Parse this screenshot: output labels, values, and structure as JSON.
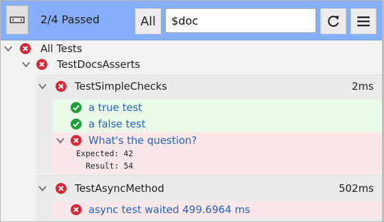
{
  "header": {
    "summary": "2/4 Passed",
    "all_label": "All",
    "search_value": "$doc"
  },
  "tree": {
    "root": {
      "label": "All Tests"
    },
    "suite": {
      "label": "TestDocsAsserts"
    },
    "groups": [
      {
        "label": "TestSimpleChecks",
        "time": "2ms",
        "tests": [
          {
            "label": "a true test",
            "status": "pass"
          },
          {
            "label": "a false test",
            "status": "pass"
          },
          {
            "label": "What's the question?",
            "status": "fail",
            "expected_line": "Expected: 42",
            "result_line": "Result: 54"
          }
        ]
      },
      {
        "label": "TestAsyncMethod",
        "time": "502ms",
        "tests": [
          {
            "label": "async test waited 499.6964 ms",
            "status": "fail"
          }
        ]
      }
    ]
  },
  "colors": {
    "header_bg": "#86aef8",
    "fail": "#d32a3a",
    "pass": "#1f9e3a",
    "link": "#2563c9",
    "pass_row_bg": "#e9fbe8",
    "fail_row_bg": "#fbe7e7"
  },
  "icons": {
    "left_button": "panel-toggle-icon",
    "reload": "reload-icon",
    "menu": "hamburger-menu-icon",
    "expand": "chevron-down-icon",
    "fail": "fail-circle-x-icon",
    "pass": "pass-circle-check-icon"
  }
}
